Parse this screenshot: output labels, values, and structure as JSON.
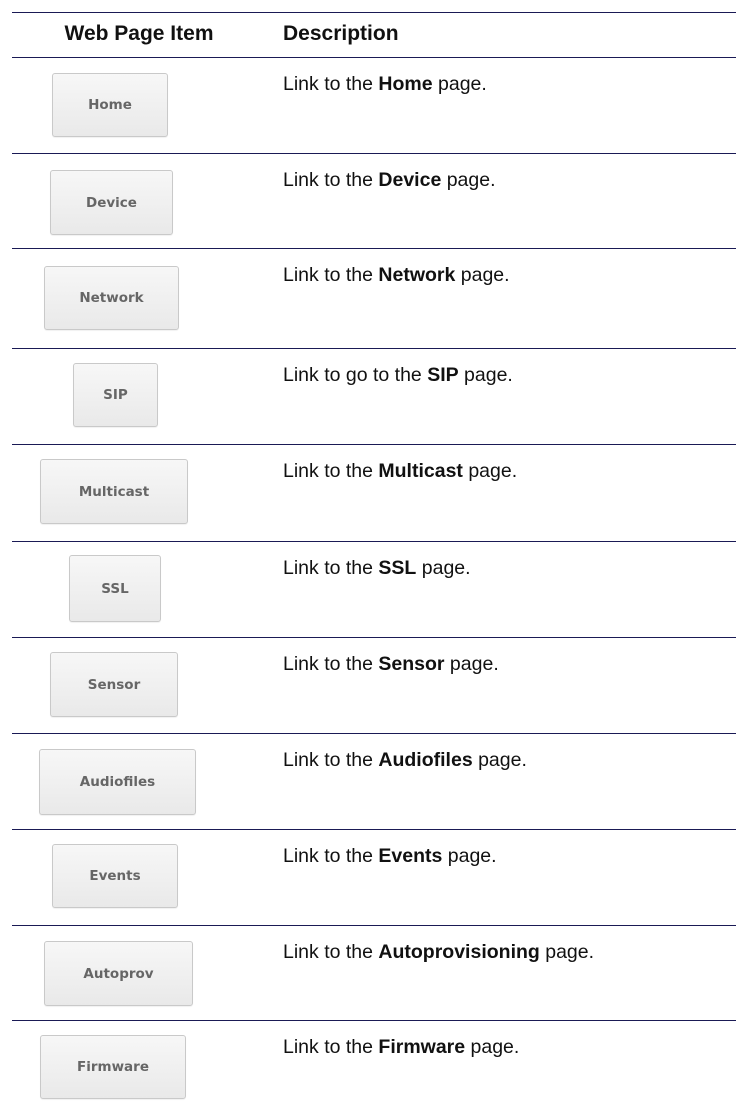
{
  "table": {
    "headers": {
      "item": "Web Page Item",
      "description": "Description"
    },
    "rows": [
      {
        "button": "Home",
        "prefix": "Link to the ",
        "bold": "Home",
        "suffix": " page."
      },
      {
        "button": "Device",
        "prefix": "Link to the ",
        "bold": "Device",
        "suffix": " page."
      },
      {
        "button": "Network",
        "prefix": "Link to the ",
        "bold": "Network",
        "suffix": " page."
      },
      {
        "button": "SIP",
        "prefix": "Link to go to the ",
        "bold": "SIP",
        "suffix": " page."
      },
      {
        "button": "Multicast",
        "prefix": "Link to the ",
        "bold": "Multicast",
        "suffix": " page."
      },
      {
        "button": "SSL",
        "prefix": "Link to the ",
        "bold": "SSL",
        "suffix": " page."
      },
      {
        "button": "Sensor",
        "prefix": "Link to the ",
        "bold": "Sensor",
        "suffix": " page."
      },
      {
        "button": "Audiofiles",
        "prefix": "Link to the ",
        "bold": "Audiofiles",
        "suffix": " page."
      },
      {
        "button": "Events",
        "prefix": "Link to the ",
        "bold": "Events",
        "suffix": " page."
      },
      {
        "button": "Autoprov",
        "prefix": "Link to the ",
        "bold": "Autoprovisioning",
        "suffix": " page."
      },
      {
        "button": "Firmware",
        "prefix": "Link to the ",
        "bold": "Firmware",
        "suffix": " page."
      }
    ]
  },
  "colors": {
    "rule": "#1a1a55",
    "button_text": "#666666",
    "button_border": "#c9c9c9"
  }
}
